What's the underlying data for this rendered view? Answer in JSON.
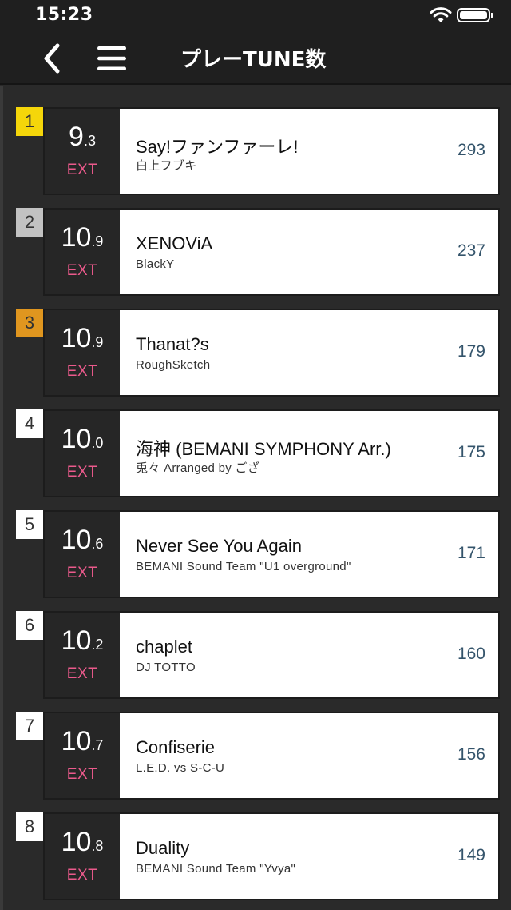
{
  "status": {
    "time": "15:23"
  },
  "nav": {
    "title": "プレーTUNE数"
  },
  "colors": {
    "gold": "#f5d60a",
    "silver": "#c2c2c2",
    "bronze": "#e0961f",
    "default_rank": "#ffffff",
    "ext": "#ec5a8c"
  },
  "songs": [
    {
      "rank": "1",
      "level": "9",
      "level_decimal": ".3",
      "difficulty": "EXT",
      "title": "Say!ファンファーレ!",
      "artist": "白上フブキ",
      "count": "293",
      "rank_color": "#f5d60a"
    },
    {
      "rank": "2",
      "level": "10",
      "level_decimal": ".9",
      "difficulty": "EXT",
      "title": "XENOViA",
      "artist": "BlackY",
      "count": "237",
      "rank_color": "#c2c2c2"
    },
    {
      "rank": "3",
      "level": "10",
      "level_decimal": ".9",
      "difficulty": "EXT",
      "title": "Thanat?s",
      "artist": "RoughSketch",
      "count": "179",
      "rank_color": "#e0961f"
    },
    {
      "rank": "4",
      "level": "10",
      "level_decimal": ".0",
      "difficulty": "EXT",
      "title": "海神 (BEMANI SYMPHONY Arr.)",
      "artist": "兎々 Arranged by ござ",
      "count": "175",
      "rank_color": "#ffffff"
    },
    {
      "rank": "5",
      "level": "10",
      "level_decimal": ".6",
      "difficulty": "EXT",
      "title": "Never See You Again",
      "artist": "BEMANI Sound Team \"U1 overground\"",
      "count": "171",
      "rank_color": "#ffffff"
    },
    {
      "rank": "6",
      "level": "10",
      "level_decimal": ".2",
      "difficulty": "EXT",
      "title": "chaplet",
      "artist": "DJ TOTTO",
      "count": "160",
      "rank_color": "#ffffff"
    },
    {
      "rank": "7",
      "level": "10",
      "level_decimal": ".7",
      "difficulty": "EXT",
      "title": "Confiserie",
      "artist": "L.E.D. vs S-C-U",
      "count": "156",
      "rank_color": "#ffffff"
    },
    {
      "rank": "8",
      "level": "10",
      "level_decimal": ".8",
      "difficulty": "EXT",
      "title": "Duality",
      "artist": "BEMANI Sound Team \"Yvya\"",
      "count": "149",
      "rank_color": "#ffffff"
    }
  ]
}
